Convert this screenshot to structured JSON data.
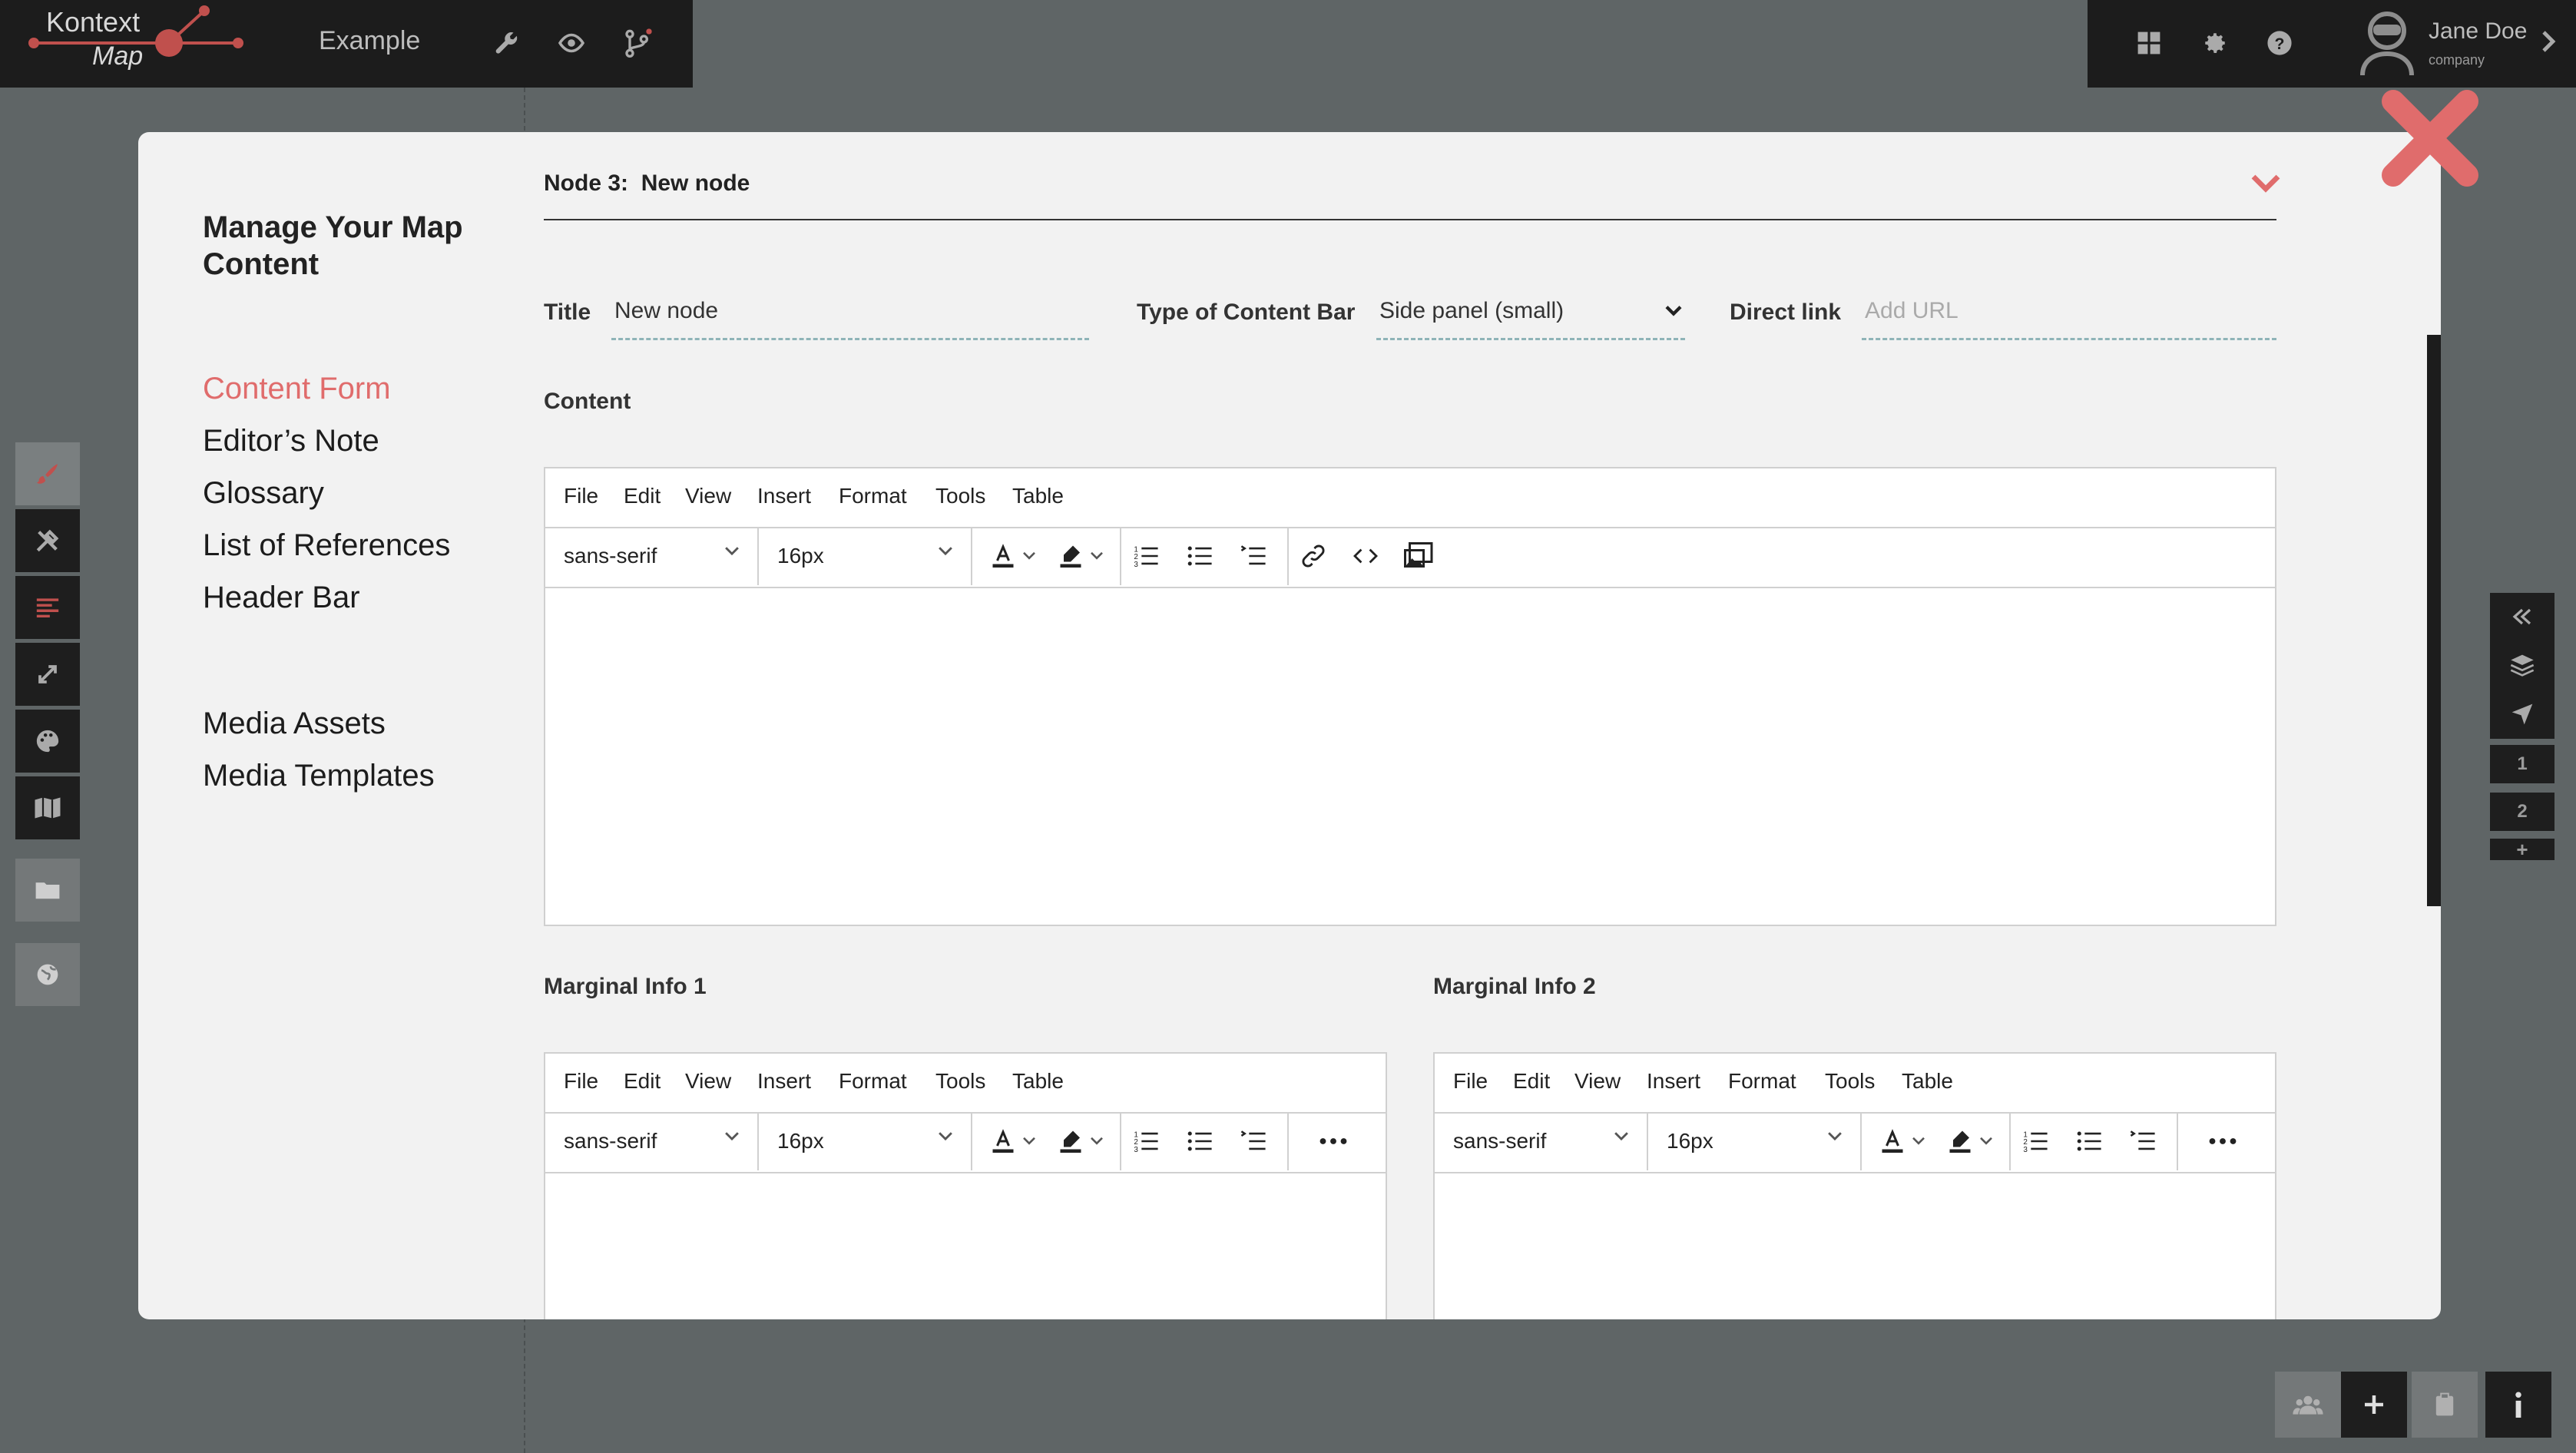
{
  "app": {
    "logo_line1": "Kontext",
    "logo_line2": "Map",
    "project_title": "Example"
  },
  "user": {
    "name": "Jane Doe",
    "company": "company"
  },
  "right_panel": {
    "pages": [
      "1",
      "2"
    ],
    "add": "+"
  },
  "sidebar": {
    "heading": "Manage Your Map Content",
    "links": [
      {
        "label": "Content Form",
        "active": true
      },
      {
        "label": "Editor’s Note"
      },
      {
        "label": "Glossary"
      },
      {
        "label": "List of References"
      },
      {
        "label": "Header Bar"
      }
    ],
    "media_links": [
      {
        "label": "Media Assets"
      },
      {
        "label": "Media Templates"
      }
    ]
  },
  "node": {
    "prefix": "Node 3:",
    "name": "New node"
  },
  "fields": {
    "title_label": "Title",
    "title_value": "New node",
    "content_bar_label": "Type of Content Bar",
    "content_bar_value": "Side panel (small)",
    "direct_link_label": "Direct link",
    "direct_link_placeholder": "Add URL"
  },
  "content": {
    "label": "Content"
  },
  "editor": {
    "menu": [
      "File",
      "Edit",
      "View",
      "Insert",
      "Format",
      "Tools",
      "Table"
    ],
    "font_family": "sans-serif",
    "font_size": "16px"
  },
  "marginal": {
    "label1": "Marginal Info 1",
    "label2": "Marginal Info 2"
  },
  "colors": {
    "accent": "#e06c6c",
    "dark": "#1c1c1c",
    "modal_bg": "#f2f2f2"
  }
}
